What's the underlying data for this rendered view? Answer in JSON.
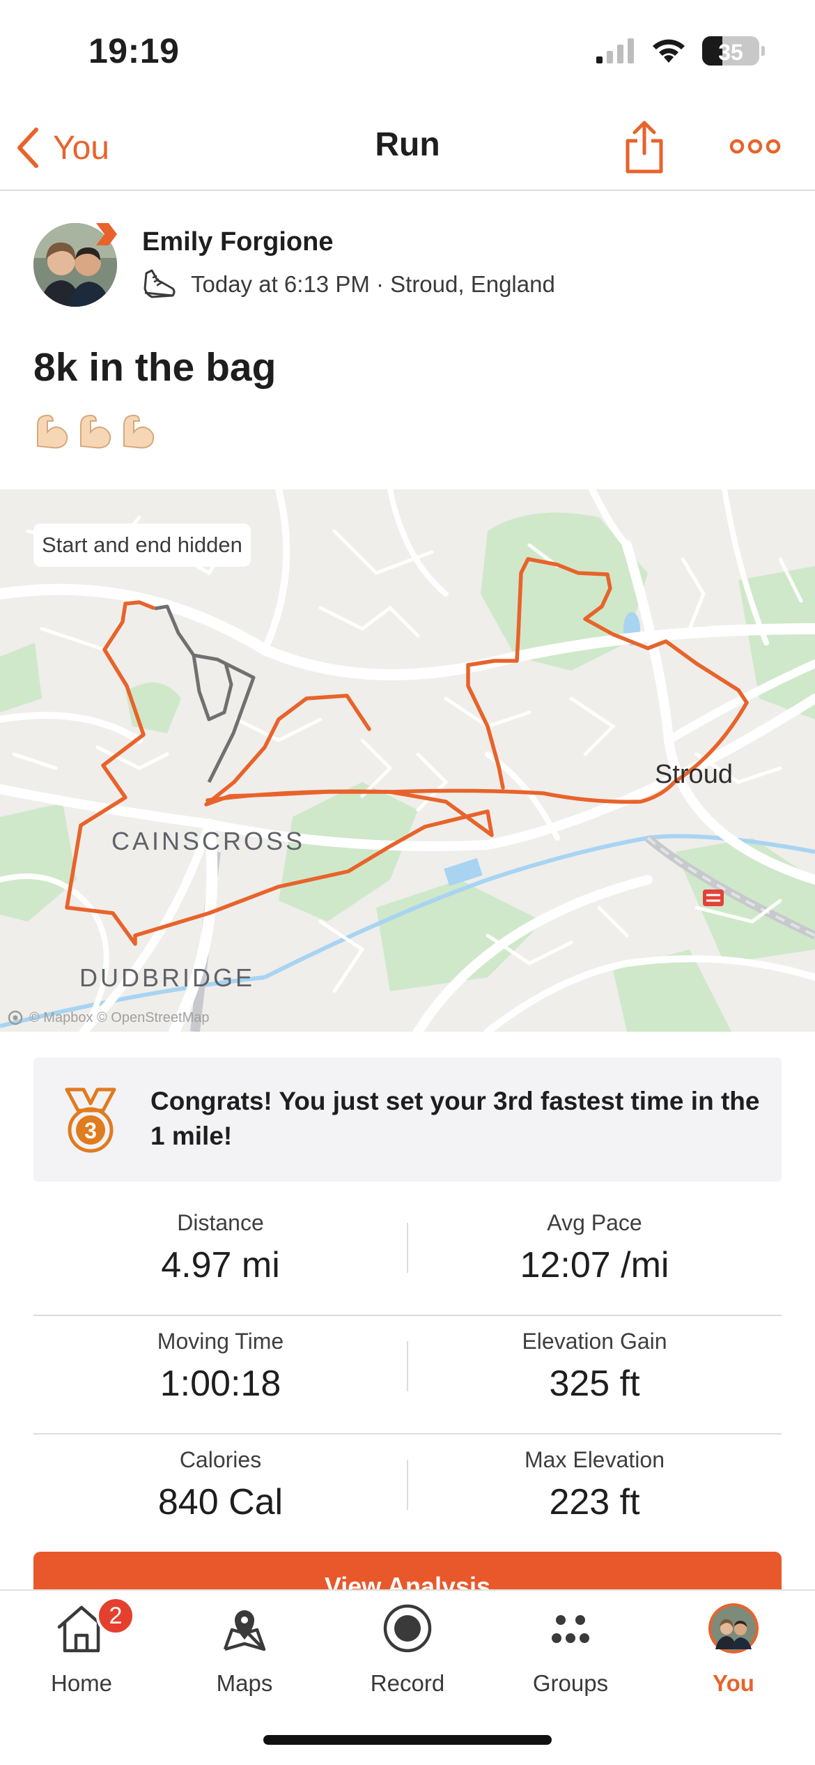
{
  "status_bar": {
    "time": "19:19",
    "battery": "35",
    "battery_level": 0.35
  },
  "nav": {
    "back_label": "You",
    "title": "Run"
  },
  "athlete": {
    "name": "Emily Forgione",
    "meta": "Today at 6:13 PM · Stroud, England"
  },
  "activity": {
    "title": "8k in the bag",
    "emoji": [
      "💪🏻",
      "💪🏻",
      "💪🏻"
    ]
  },
  "map": {
    "privacy_pill": "Start and end hidden",
    "labels": {
      "cainscross": "CAINSCROSS",
      "dudbridge": "DUDBRIDGE",
      "stroud": "Stroud"
    },
    "attribution": "© Mapbox © OpenStreetMap",
    "route_color": "#e8632b",
    "hidden_route_color": "#707070"
  },
  "achievement": {
    "text": "Congrats! You just set your 3rd fastest time in the 1 mile!",
    "medal_rank": "3",
    "medal_color": "#e07b1e"
  },
  "stats": [
    {
      "left": {
        "label": "Distance",
        "value": "4.97 mi"
      },
      "right": {
        "label": "Avg Pace",
        "value": "12:07 /mi"
      }
    },
    {
      "left": {
        "label": "Moving Time",
        "value": "1:00:18"
      },
      "right": {
        "label": "Elevation Gain",
        "value": "325 ft"
      }
    },
    {
      "left": {
        "label": "Calories",
        "value": "840 Cal"
      },
      "right": {
        "label": "Max Elevation",
        "value": "223 ft"
      }
    }
  ],
  "analysis_button": "View Analysis",
  "tabs": [
    {
      "label": "Home",
      "badge": "2"
    },
    {
      "label": "Maps"
    },
    {
      "label": "Record"
    },
    {
      "label": "Groups"
    },
    {
      "label": "You",
      "active": true
    }
  ],
  "colors": {
    "accent": "#e8632b",
    "badge": "#e5402e"
  }
}
